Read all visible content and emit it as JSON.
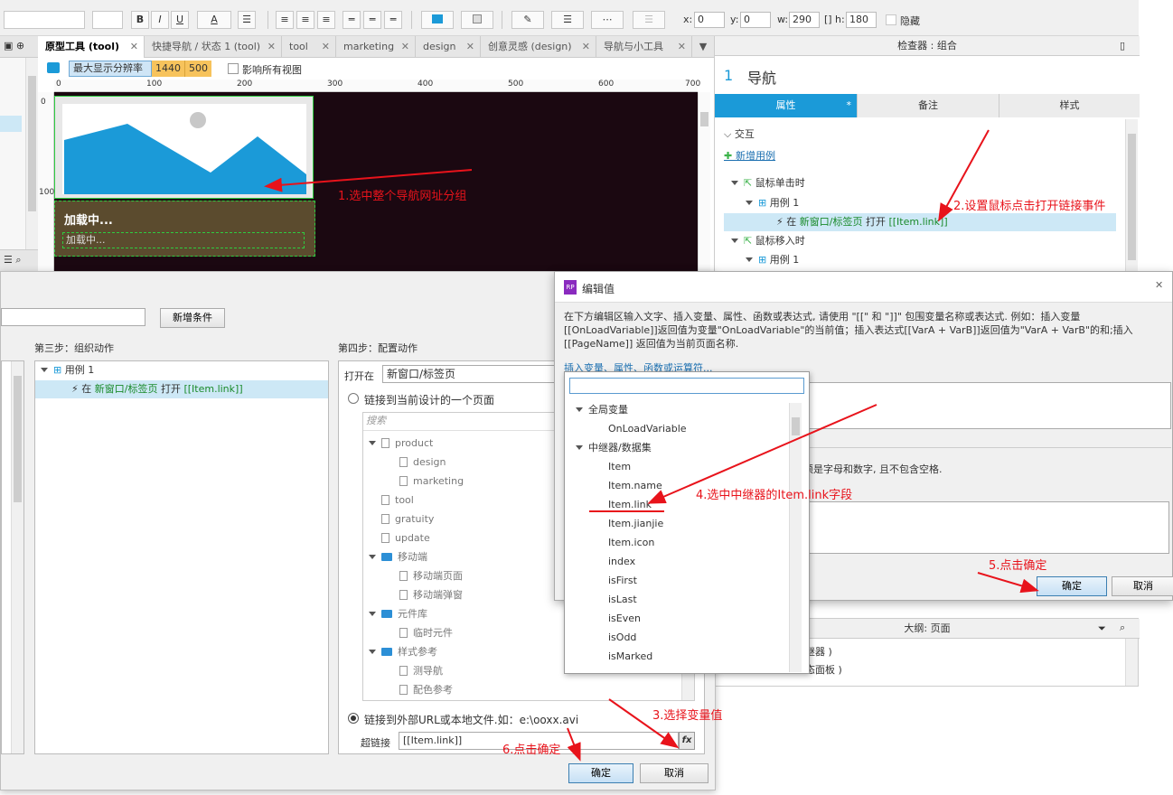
{
  "toolbar": {
    "bold": "B",
    "italic": "I",
    "underline": "U",
    "font_color": "A",
    "x_label": "x:",
    "x_value": "0",
    "y_label": "y:",
    "y_value": "0",
    "w_label": "w:",
    "w_value": "290",
    "h_label": "h:",
    "h_value": "180",
    "hidden_label": "隐藏"
  },
  "tabs": [
    {
      "label": "原型工具 (tool)",
      "active": true
    },
    {
      "label": "快捷导航 / 状态 1 (tool)"
    },
    {
      "label": "tool"
    },
    {
      "label": "marketing"
    },
    {
      "label": "design"
    },
    {
      "label": "创意灵感 (design)"
    },
    {
      "label": "导航与小工具"
    }
  ],
  "canvas_bar": {
    "resolution_label": "最大显示分辨率",
    "res1": "1440",
    "res2": "500",
    "affect_label": "影响所有视图"
  },
  "ruler": {
    "h": [
      "0",
      "100",
      "200",
      "300",
      "400",
      "500",
      "600",
      "700"
    ],
    "v": [
      "0",
      "100"
    ]
  },
  "canvas": {
    "loading_title": "加载中...",
    "loading_sub": "加载中..."
  },
  "inspector": {
    "header": "检查器 : 组合",
    "num": "1",
    "name": "导航",
    "tabs": [
      "属性",
      "备注",
      "样式"
    ],
    "asterisk": "*",
    "section": "交互",
    "add_case": "新增用例",
    "events": [
      {
        "label": "鼠标单击时",
        "case": "用例 1",
        "action_prefix": "在",
        "action_target": "新窗口/标签页",
        "action_verb": "打开",
        "action_value": "[[Item.link]]"
      },
      {
        "label": "鼠标移入时",
        "case": "用例 1"
      }
    ]
  },
  "annotations": {
    "a1": "1.选中整个导航网址分组",
    "a2": "2.设置鼠标点击打开链接事件",
    "a3": "3.选择变量值",
    "a4": "4.选中中继器的Item.link字段",
    "a5": "5.点击确定",
    "a6": "6.点击确定"
  },
  "case_editor": {
    "add_condition": "新增条件",
    "step3": "第三步：组织动作",
    "step4": "第四步：配置动作",
    "case_label": "用例 1",
    "action_prefix": "在",
    "action_target": "新窗口/标签页",
    "action_verb": "打开",
    "action_value": "[[Item.link]]",
    "open_in_label": "打开在",
    "open_in_value": "新窗口/标签页",
    "radio_page": "链接到当前设计的一个页面",
    "search_placeholder": "搜索",
    "pages": [
      {
        "label": "product",
        "level": 0,
        "type": "file",
        "expand": true
      },
      {
        "label": "design",
        "level": 1,
        "type": "file"
      },
      {
        "label": "marketing",
        "level": 1,
        "type": "file"
      },
      {
        "label": "tool",
        "level": 0,
        "type": "file"
      },
      {
        "label": "gratuity",
        "level": 0,
        "type": "file"
      },
      {
        "label": "update",
        "level": 0,
        "type": "file"
      },
      {
        "label": "移动端",
        "level": 0,
        "type": "folder",
        "expand": true
      },
      {
        "label": "移动端页面",
        "level": 1,
        "type": "file"
      },
      {
        "label": "移动端弹窗",
        "level": 1,
        "type": "file"
      },
      {
        "label": "元件库",
        "level": 0,
        "type": "folder",
        "expand": true
      },
      {
        "label": "临时元件",
        "level": 1,
        "type": "file"
      },
      {
        "label": "样式参考",
        "level": 0,
        "type": "folder",
        "expand": true
      },
      {
        "label": "测导航",
        "level": 1,
        "type": "file"
      },
      {
        "label": "配色参考",
        "level": 1,
        "type": "file"
      }
    ],
    "radio_url": "链接到外部URL或本地文件.如：e:\\ooxx.avi",
    "hyperlink_label": "超链接",
    "hyperlink_value": "[[Item.link]]",
    "fx": "fx",
    "ok": "确定",
    "cancel": "取消"
  },
  "edit_value": {
    "title": "编辑值",
    "logo": "RP",
    "desc": "在下方编辑区输入文字、插入变量、属性、函数或表达式, 请使用 \"[[\" 和 \"]]\" 包围变量名称或表达式. 例如：插入变量[[OnLoadVariable]]返回值为变量\"OnLoadVariable\"的当前值；插入表达式[[VarA + VarB]]返回值为\"VarA + VarB\"的和;插入[[PageName]] 返回值为当前页面名称.",
    "insert_link": "插入变量、属性、函数或运算符...",
    "hint": "须是字母和数字, 且不包含空格.",
    "ok": "确定",
    "cancel": "取消"
  },
  "popup": {
    "groups": [
      {
        "label": "全局变量",
        "items": [
          "OnLoadVariable"
        ]
      },
      {
        "label": "中继器/数据集",
        "items": [
          "Item",
          "Item.name",
          "Item.link",
          "Item.jianjie",
          "Item.icon",
          "index",
          "isFirst",
          "isLast",
          "isEven",
          "isOdd",
          "isMarked"
        ]
      }
    ]
  },
  "outline": {
    "header": "大纲: 页面",
    "row1": "继器 )",
    "row2": "态面板 )"
  },
  "colors": {
    "accent": "#1b9ad8",
    "annotation": "#e8131b",
    "canvas_bg": "#1b0811",
    "image_blue": "#1b9ad8"
  }
}
